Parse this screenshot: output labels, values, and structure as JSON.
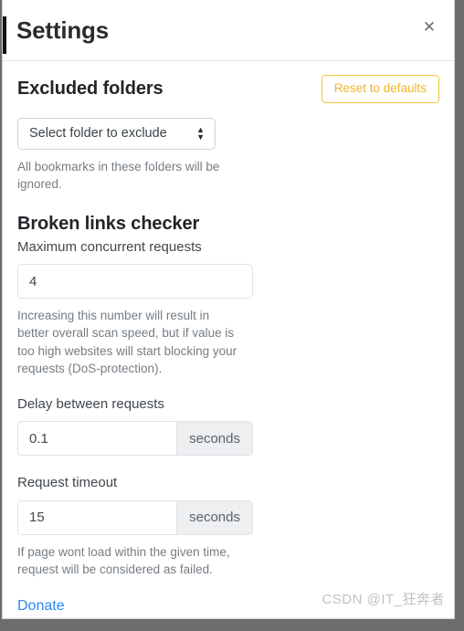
{
  "window": {
    "title": "Settings",
    "close_icon": "close-icon"
  },
  "sections": {
    "excluded_folders": {
      "heading": "Excluded folders",
      "reset_button": "Reset to defaults",
      "select": {
        "value": "Select folder to exclude",
        "options": [
          "Select folder to exclude"
        ],
        "arrow_icon": "updown-arrows-icon"
      },
      "help": "All bookmarks in these folders will be ignored."
    },
    "broken_links_checker": {
      "heading": "Broken links checker",
      "max_concurrent": {
        "label": "Maximum concurrent requests",
        "value": "4",
        "help": "Increasing this number will result in better overall scan speed, but if value is too high websites will start blocking your requests (DoS-protection)."
      },
      "delay": {
        "label": "Delay between requests",
        "value": "0.1",
        "unit": "seconds"
      },
      "timeout": {
        "label": "Request timeout",
        "value": "15",
        "unit": "seconds",
        "help": "If page wont load within the given time, request will be considered as failed."
      }
    }
  },
  "footer": {
    "donate_label": "Donate"
  },
  "watermark": {
    "text": "CSDN @IT_狂奔者"
  },
  "colors": {
    "accent_yellow": "#f0b72b",
    "link_blue": "#2a87f5",
    "panel_bg": "#ffffff",
    "backdrop": "#6d6d6d",
    "muted_text": "#757d84"
  }
}
